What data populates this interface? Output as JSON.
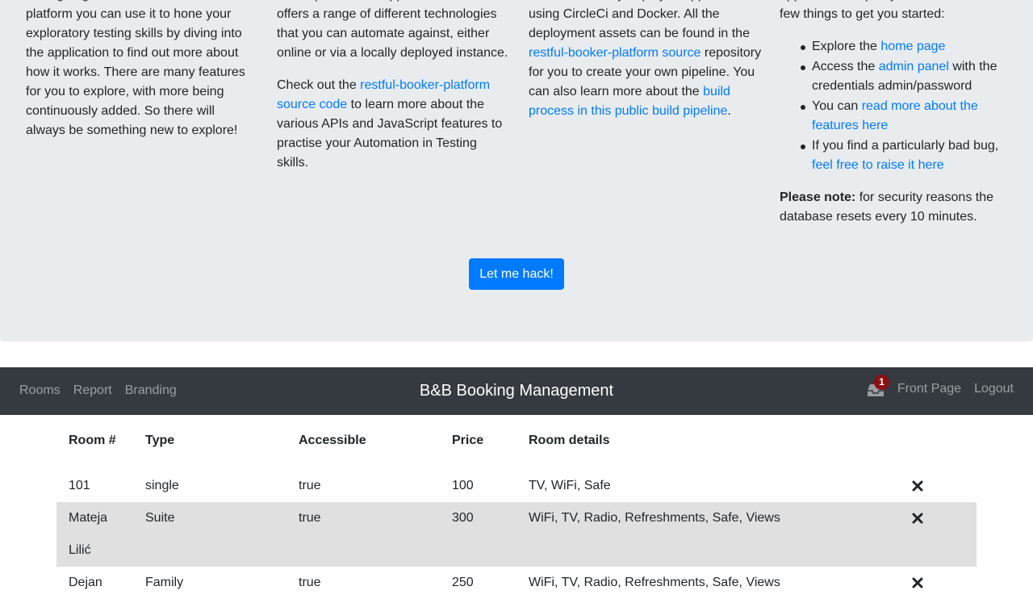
{
  "intro": {
    "col1_text": "finding bugs. With Restful-booker-platform you can use it to hone your exploratory testing skills by diving into the application to find out more about how it works. There are many features for you to explore, with more being continuously added. So there will always be something new to explore!",
    "col2_p1": "is an open source application and it offers a range of different technologies that you can automate against, either online or via a locally deployed instance.",
    "col2_p2_before": "Check out the ",
    "col2_p2_link": "restful-booker-platform source code",
    "col2_p2_after": " to learn more about the various APIs and JavaScript features to practise your Automation in Testing skills.",
    "col3_before": "is a continuously deployed application using CircleCi and Docker. All the deployment assets can be found in the ",
    "col3_link1": "restful-booker-platform source",
    "col3_middle": " repository for you to create your own pipeline. You can also learn more about the ",
    "col3_link2": "build process in this public build pipeline",
    "col3_after": ".",
    "col4_intro": "application is up to you, but here are a few things to get you started:",
    "list": [
      {
        "before": "Explore the ",
        "link": "home page",
        "after": ""
      },
      {
        "before": "Access the ",
        "link": "admin panel",
        "after": " with the credentials admin/password"
      },
      {
        "before": "You can ",
        "link": "read more about the features here",
        "after": ""
      },
      {
        "before": "If you find a particularly bad bug, ",
        "link": "feel free to raise it here",
        "after": ""
      }
    ],
    "note_label": "Please note:",
    "note_text": " for security reasons the database resets every 10 minutes.",
    "hack_button": "Let me hack!"
  },
  "navbar": {
    "links": [
      "Rooms",
      "Report",
      "Branding"
    ],
    "brand": "B&B Booking Management",
    "inbox_icon": "inbox-icon",
    "notification_count": "1",
    "front_page": "Front Page",
    "logout": "Logout",
    "bg_color": "#343a40"
  },
  "rooms_table": {
    "headers": [
      "Room #",
      "Type",
      "Accessible",
      "Price",
      "Room details"
    ],
    "rows": [
      {
        "room": "101",
        "type": "single",
        "accessible": "true",
        "price": "100",
        "details": "TV, WiFi, Safe"
      },
      {
        "room": "Mateja Lilić",
        "type": "Suite",
        "accessible": "true",
        "price": "300",
        "details": "WiFi, TV, Radio, Refreshments, Safe, Views"
      },
      {
        "room": "Dejan",
        "type": "Family",
        "accessible": "true",
        "price": "250",
        "details": "WiFi, TV, Radio, Refreshments, Safe, Views"
      }
    ],
    "delete_icon": "delete-icon"
  },
  "colors": {
    "accent": "#007bff",
    "jumbotron_bg": "#e9ecef",
    "badge": "#8b1014",
    "highlight_row": "#e0e0e0"
  }
}
